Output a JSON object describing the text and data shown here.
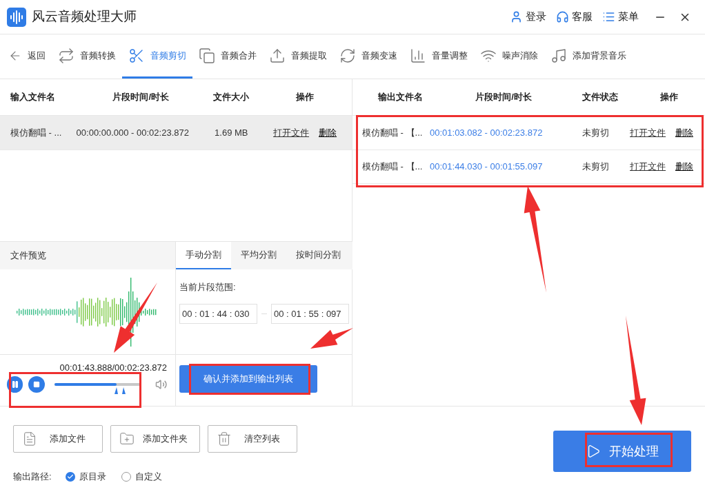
{
  "window": {
    "title": "风云音频处理大师"
  },
  "header_menu": [
    {
      "label": "登录"
    },
    {
      "label": "客服"
    },
    {
      "label": "菜单"
    }
  ],
  "toolbar": [
    {
      "label": "返回",
      "selected": false
    },
    {
      "label": "音频转换",
      "selected": false
    },
    {
      "label": "音频剪切",
      "selected": true
    },
    {
      "label": "音频合并",
      "selected": false
    },
    {
      "label": "音频提取",
      "selected": false
    },
    {
      "label": "音频变速",
      "selected": false
    },
    {
      "label": "音量调整",
      "selected": false
    },
    {
      "label": "噪声消除",
      "selected": false
    },
    {
      "label": "添加背景音乐",
      "selected": false
    }
  ],
  "input_table": {
    "columns": [
      "输入文件名",
      "片段时间/时长",
      "文件大小",
      "操作"
    ],
    "rows": [
      {
        "name": "模仿翻唱 - ...",
        "time": "00:00:00.000 - 00:02:23.872",
        "size": "1.69 MB",
        "open": "打开文件",
        "delete": "删除",
        "selected": true
      }
    ]
  },
  "output_table": {
    "columns": [
      "输出文件名",
      "片段时间/时长",
      "文件状态",
      "操作"
    ],
    "rows": [
      {
        "name": "模仿翻唱 - 【...",
        "time": "00:01:03.082 - 00:02:23.872",
        "status": "未剪切",
        "open": "打开文件",
        "delete": "删除"
      },
      {
        "name": "模仿翻唱 - 【...",
        "time": "00:01:44.030 - 00:01:55.097",
        "status": "未剪切",
        "open": "打开文件",
        "delete": "删除"
      }
    ]
  },
  "preview": {
    "title": "文件预览",
    "time": "00:01:43.888/00:02:23.872",
    "playing": true,
    "progress": {
      "level": 0.72
    }
  },
  "split_tabs": [
    {
      "label": "手动分割",
      "selected": true
    },
    {
      "label": "平均分割",
      "selected": false
    },
    {
      "label": "按时间分割",
      "selected": false
    }
  ],
  "segment": {
    "label": "当前片段范围:",
    "start": "00 : 01 : 44 : 030",
    "end": "00 : 01 : 55 : 097",
    "confirm_button": "确认并添加到输出列表"
  },
  "bottom_buttons": [
    "添加文件",
    "添加文件夹",
    "清空列表"
  ],
  "start_button": "开始处理",
  "output_path": {
    "label": "输出路径:",
    "options": [
      {
        "label": "原目录",
        "selected": true
      },
      {
        "label": "自定义",
        "selected": false
      }
    ]
  }
}
